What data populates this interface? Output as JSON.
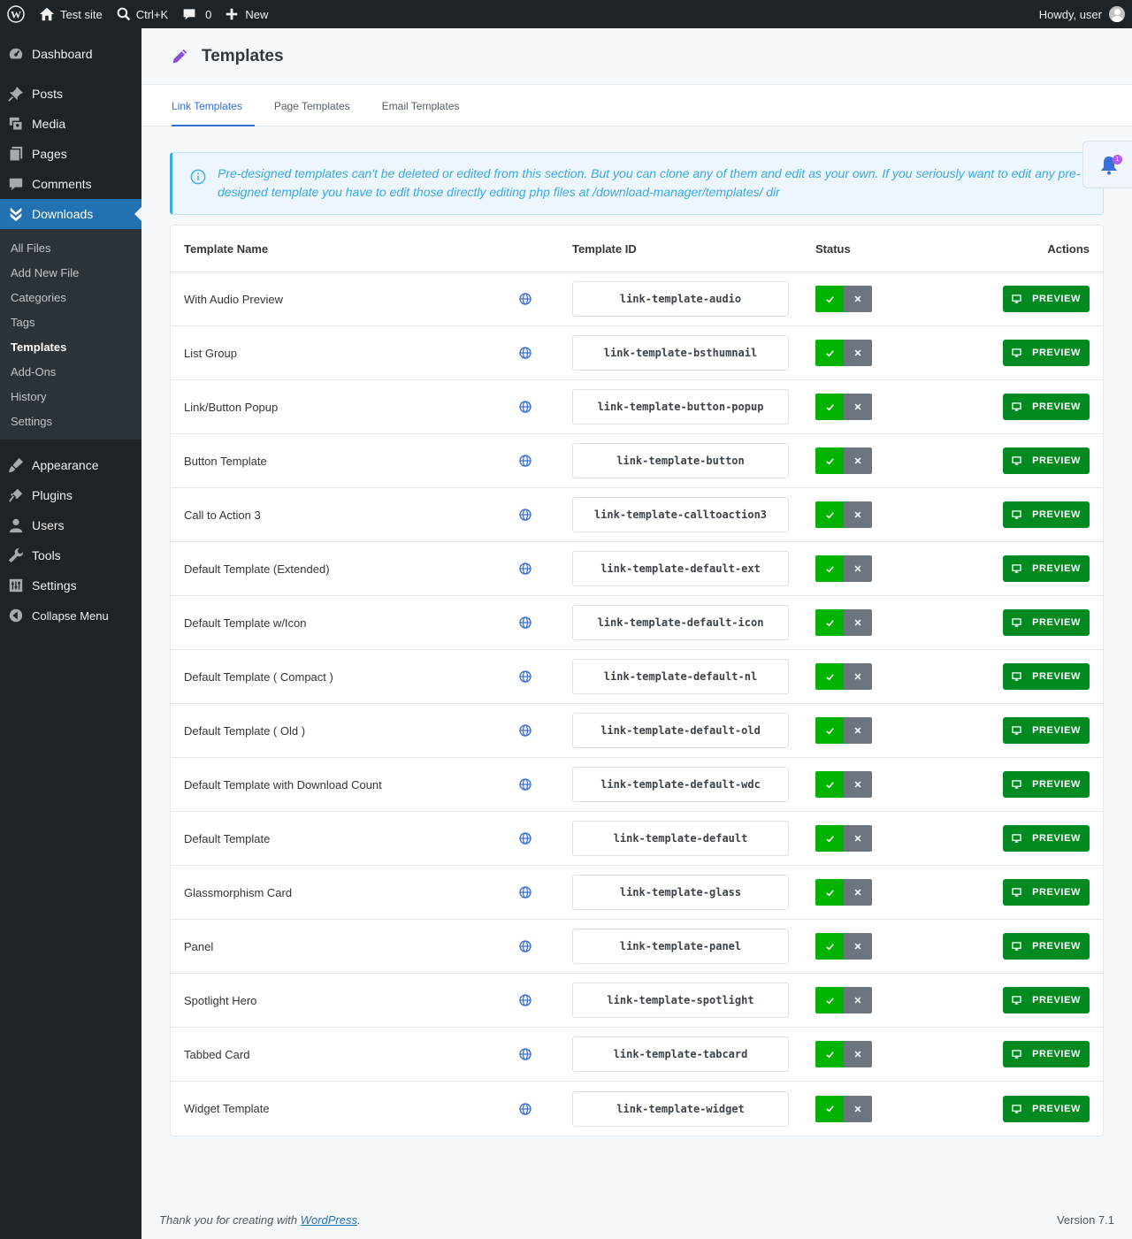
{
  "adminbar": {
    "site_name": "Test site",
    "search_shortcut": "Ctrl+K",
    "comments_count": "0",
    "new_label": "New",
    "howdy": "Howdy, user"
  },
  "sidebar": {
    "items_top": [
      {
        "label": "Dashboard",
        "icon": "dashboard-icon"
      },
      {
        "label": "Posts",
        "icon": "pin-icon"
      },
      {
        "label": "Media",
        "icon": "media-icon"
      },
      {
        "label": "Pages",
        "icon": "pages-icon"
      },
      {
        "label": "Comments",
        "icon": "comment-icon"
      },
      {
        "label": "Downloads",
        "icon": "downloads-icon"
      }
    ],
    "submenu": [
      "All Files",
      "Add New File",
      "Categories",
      "Tags",
      "Templates",
      "Add-Ons",
      "History",
      "Settings"
    ],
    "current_submenu": "Templates",
    "items_bottom": [
      {
        "label": "Appearance",
        "icon": "brush-icon"
      },
      {
        "label": "Plugins",
        "icon": "plug-icon"
      },
      {
        "label": "Users",
        "icon": "user-icon"
      },
      {
        "label": "Tools",
        "icon": "wrench-icon"
      },
      {
        "label": "Settings",
        "icon": "sliders-icon"
      }
    ],
    "collapse_label": "Collapse Menu"
  },
  "page": {
    "title": "Templates",
    "tabs": [
      "Link Templates",
      "Page Templates",
      "Email Templates"
    ],
    "active_tab": "Link Templates",
    "notice": "Pre-designed templates can't be deleted or edited from this section. But you can clone any of them and edit as your own. If you seriously want to edit any pre-designed template you have to edit those directly editing php files at /download-manager/templates/ dir",
    "notification_count": "1"
  },
  "table": {
    "headers": {
      "name": "Template Name",
      "id": "Template ID",
      "status": "Status",
      "actions": "Actions"
    },
    "preview_label": "PREVIEW",
    "rows": [
      {
        "name": "With Audio Preview",
        "id": "link-template-audio"
      },
      {
        "name": "List Group",
        "id": "link-template-bsthumnail"
      },
      {
        "name": "Link/Button Popup",
        "id": "link-template-button-popup"
      },
      {
        "name": "Button Template",
        "id": "link-template-button"
      },
      {
        "name": "Call to Action 3",
        "id": "link-template-calltoaction3"
      },
      {
        "name": "Default Template (Extended)",
        "id": "link-template-default-ext"
      },
      {
        "name": "Default Template w/Icon",
        "id": "link-template-default-icon"
      },
      {
        "name": "Default Template ( Compact )",
        "id": "link-template-default-nl"
      },
      {
        "name": "Default Template ( Old )",
        "id": "link-template-default-old"
      },
      {
        "name": "Default Template with Download Count",
        "id": "link-template-default-wdc"
      },
      {
        "name": "Default Template",
        "id": "link-template-default"
      },
      {
        "name": "Glassmorphism Card",
        "id": "link-template-glass"
      },
      {
        "name": "Panel",
        "id": "link-template-panel"
      },
      {
        "name": "Spotlight Hero",
        "id": "link-template-spotlight"
      },
      {
        "name": "Tabbed Card",
        "id": "link-template-tabcard"
      },
      {
        "name": "Widget Template",
        "id": "link-template-widget"
      }
    ]
  },
  "footer": {
    "thanks_prefix": "Thank you for creating with ",
    "thanks_link": "WordPress",
    "thanks_suffix": ".",
    "version": "Version 7.1"
  },
  "colors": {
    "accent": "#2271b1",
    "toggle_on": "#00b300",
    "toggle_off": "#6c757d",
    "preview": "#008a20",
    "notice_text": "#38a9e5"
  }
}
